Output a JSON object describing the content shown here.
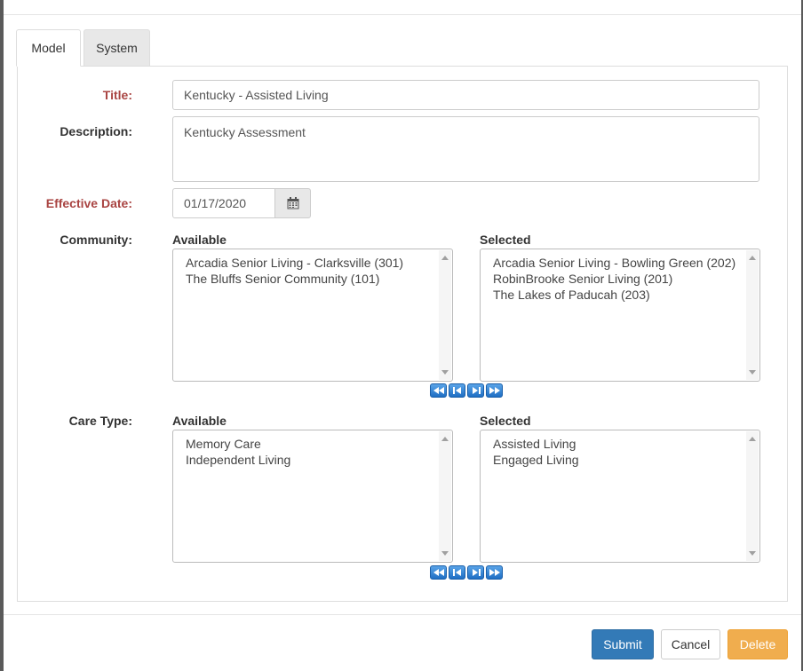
{
  "tabs": [
    {
      "label": "Model"
    },
    {
      "label": "System"
    }
  ],
  "form": {
    "title_label": "Title:",
    "title_value": "Kentucky - Assisted Living",
    "description_label": "Description:",
    "description_value": "Kentucky Assessment",
    "effective_date_label": "Effective Date:",
    "effective_date_value": "01/17/2020",
    "calendar_icon": "calendar-icon",
    "community": {
      "label": "Community:",
      "available_header": "Available",
      "selected_header": "Selected",
      "available": [
        "Arcadia Senior Living - Clarksville (301)",
        "The Bluffs Senior Community (101)"
      ],
      "selected": [
        "Arcadia Senior Living - Bowling Green (202)",
        "RobinBrooke Senior Living (201)",
        "The Lakes of Paducah (203)"
      ]
    },
    "care_type": {
      "label": "Care Type:",
      "available_header": "Available",
      "selected_header": "Selected",
      "available": [
        "Memory Care",
        "Independent Living"
      ],
      "selected": [
        "Assisted Living",
        "Engaged Living"
      ]
    },
    "mover_icons": [
      "move-all-left-icon",
      "move-left-icon",
      "move-right-icon",
      "move-all-right-icon"
    ]
  },
  "footer": {
    "submit_label": "Submit",
    "cancel_label": "Cancel",
    "delete_label": "Delete"
  },
  "colors": {
    "required_label": "#a94442",
    "submit": "#337ab7",
    "delete": "#f0ad4e"
  }
}
